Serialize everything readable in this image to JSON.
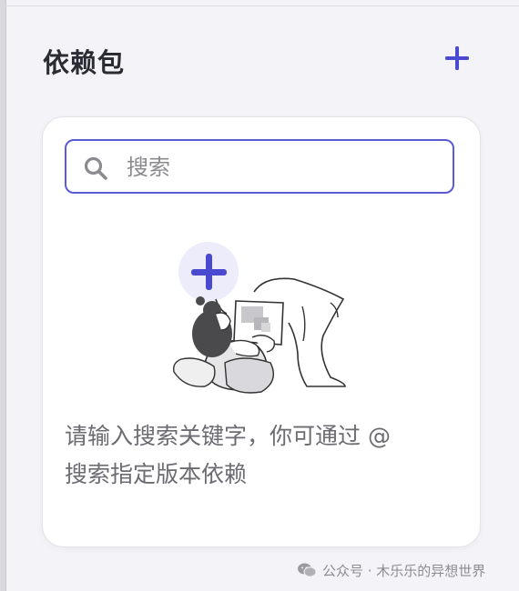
{
  "header": {
    "title": "依赖包"
  },
  "search": {
    "placeholder": "搜索",
    "value": ""
  },
  "empty_state": {
    "line1": "请输入搜索关键字，你可通过 @",
    "line2": "搜索指定版本依赖"
  },
  "watermark": {
    "text": "公众号 · 木乐乐的异想世界"
  },
  "colors": {
    "accent": "#5b5bd6",
    "text_primary": "#2b2b33",
    "text_secondary": "#6b6b72",
    "background": "#f4f4f8",
    "card": "#ffffff"
  },
  "icons": {
    "add": "plus-icon",
    "search": "search-icon",
    "watermark": "wechat-icon"
  }
}
